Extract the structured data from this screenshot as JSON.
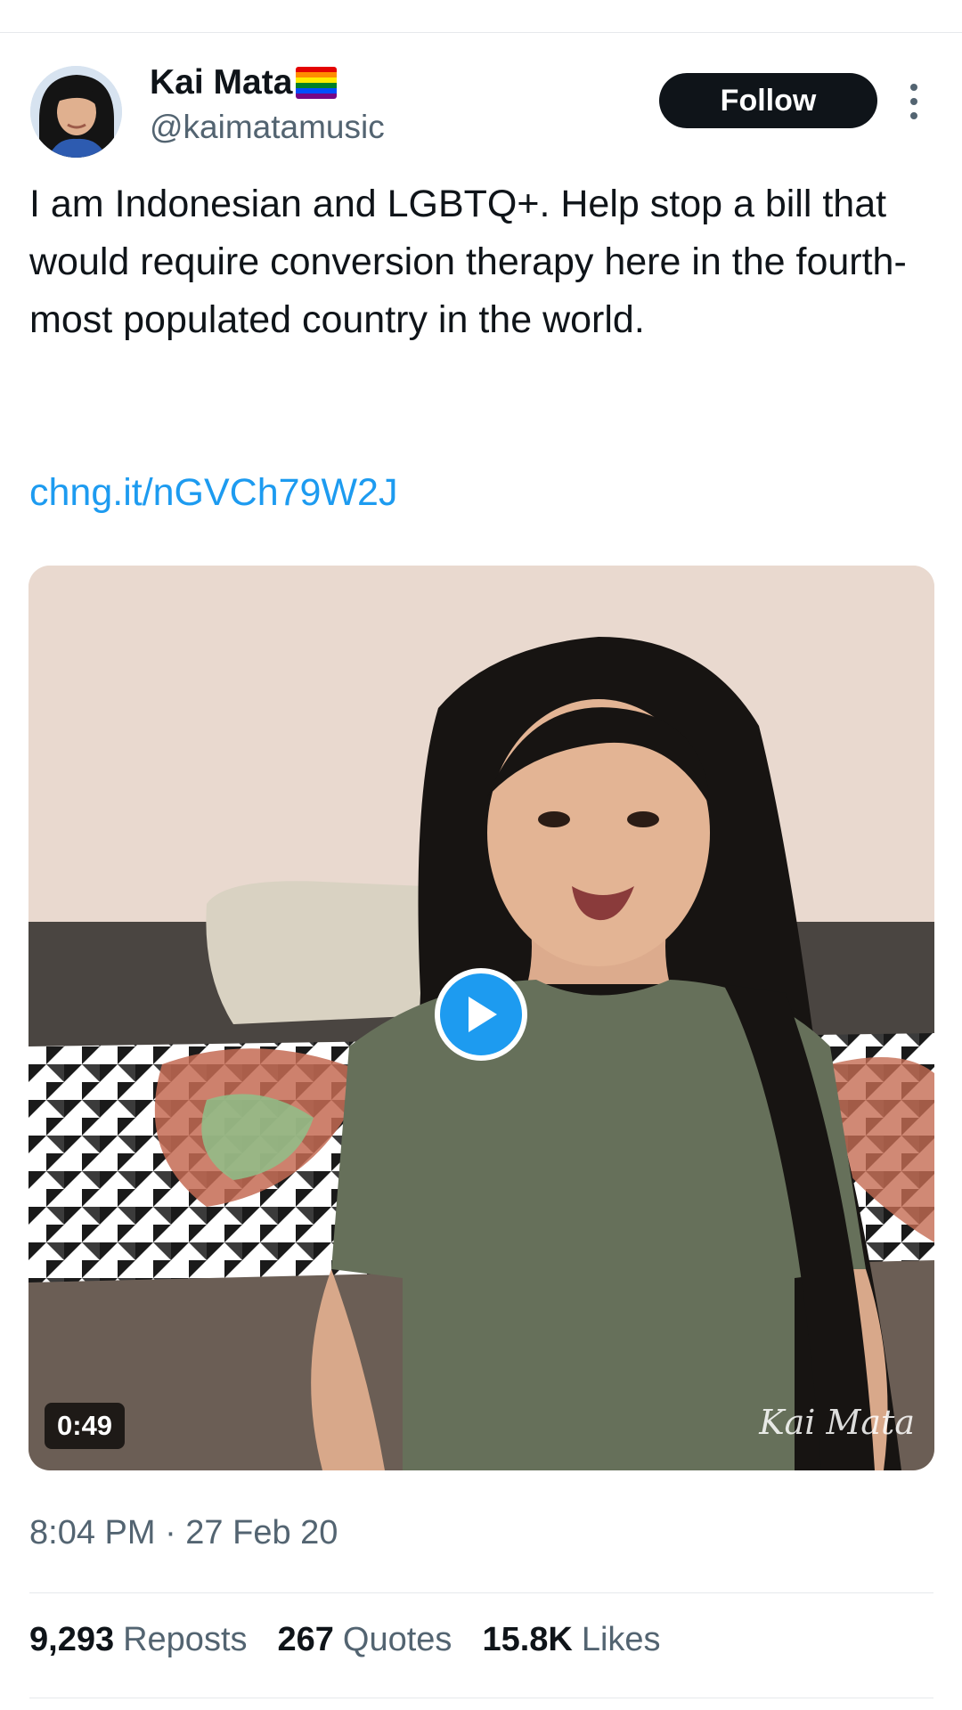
{
  "author": {
    "display_name": "Kai Mata",
    "handle": "@kaimatamusic",
    "badge_icon": "rainbow-flag-icon"
  },
  "follow_label": "Follow",
  "more_icon": "more-vertical-icon",
  "tweet": {
    "text": "I am Indonesian and LGBTQ+.  Help stop a bill that would require conversion therapy here in the fourth-most populated country in the world.",
    "link": "chng.it/nGVCh79W2J"
  },
  "media": {
    "duration": "0:49",
    "watermark": "Kai Mata",
    "play_icon": "play-icon"
  },
  "timestamp": "8:04 PM · 27 Feb 20",
  "stats": [
    {
      "value": "9,293",
      "label": "Reposts"
    },
    {
      "value": "267",
      "label": "Quotes"
    },
    {
      "value": "15.8K",
      "label": "Likes"
    }
  ],
  "colors": {
    "link": "#1d9bf0",
    "secondary_text": "#536471",
    "follow_bg": "#0f1419"
  }
}
